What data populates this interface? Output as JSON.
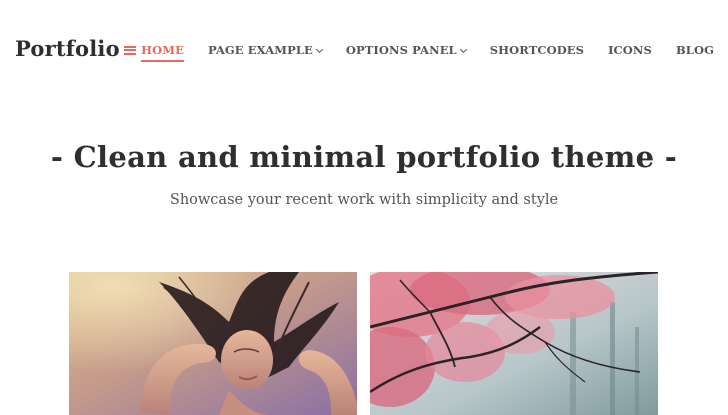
{
  "header": {
    "logo": "Portfolio",
    "nav": [
      {
        "label": "HOME",
        "active": true
      },
      {
        "label": "PAGE EXAMPLE",
        "dropdown": true
      },
      {
        "label": "OPTIONS PANEL",
        "dropdown": true
      },
      {
        "label": "SHORTCODES"
      },
      {
        "label": "ICONS"
      },
      {
        "label": "BLOG"
      }
    ]
  },
  "hero": {
    "title": "- Clean and minimal portfolio theme -",
    "subtitle": "Showcase your recent work with simplicity and style"
  },
  "colors": {
    "accent": "#e36a5d",
    "text": "#2f2f2f"
  },
  "icons": {
    "menu": "hamburger-menu-icon",
    "dropdown": "chevron-down-icon"
  }
}
